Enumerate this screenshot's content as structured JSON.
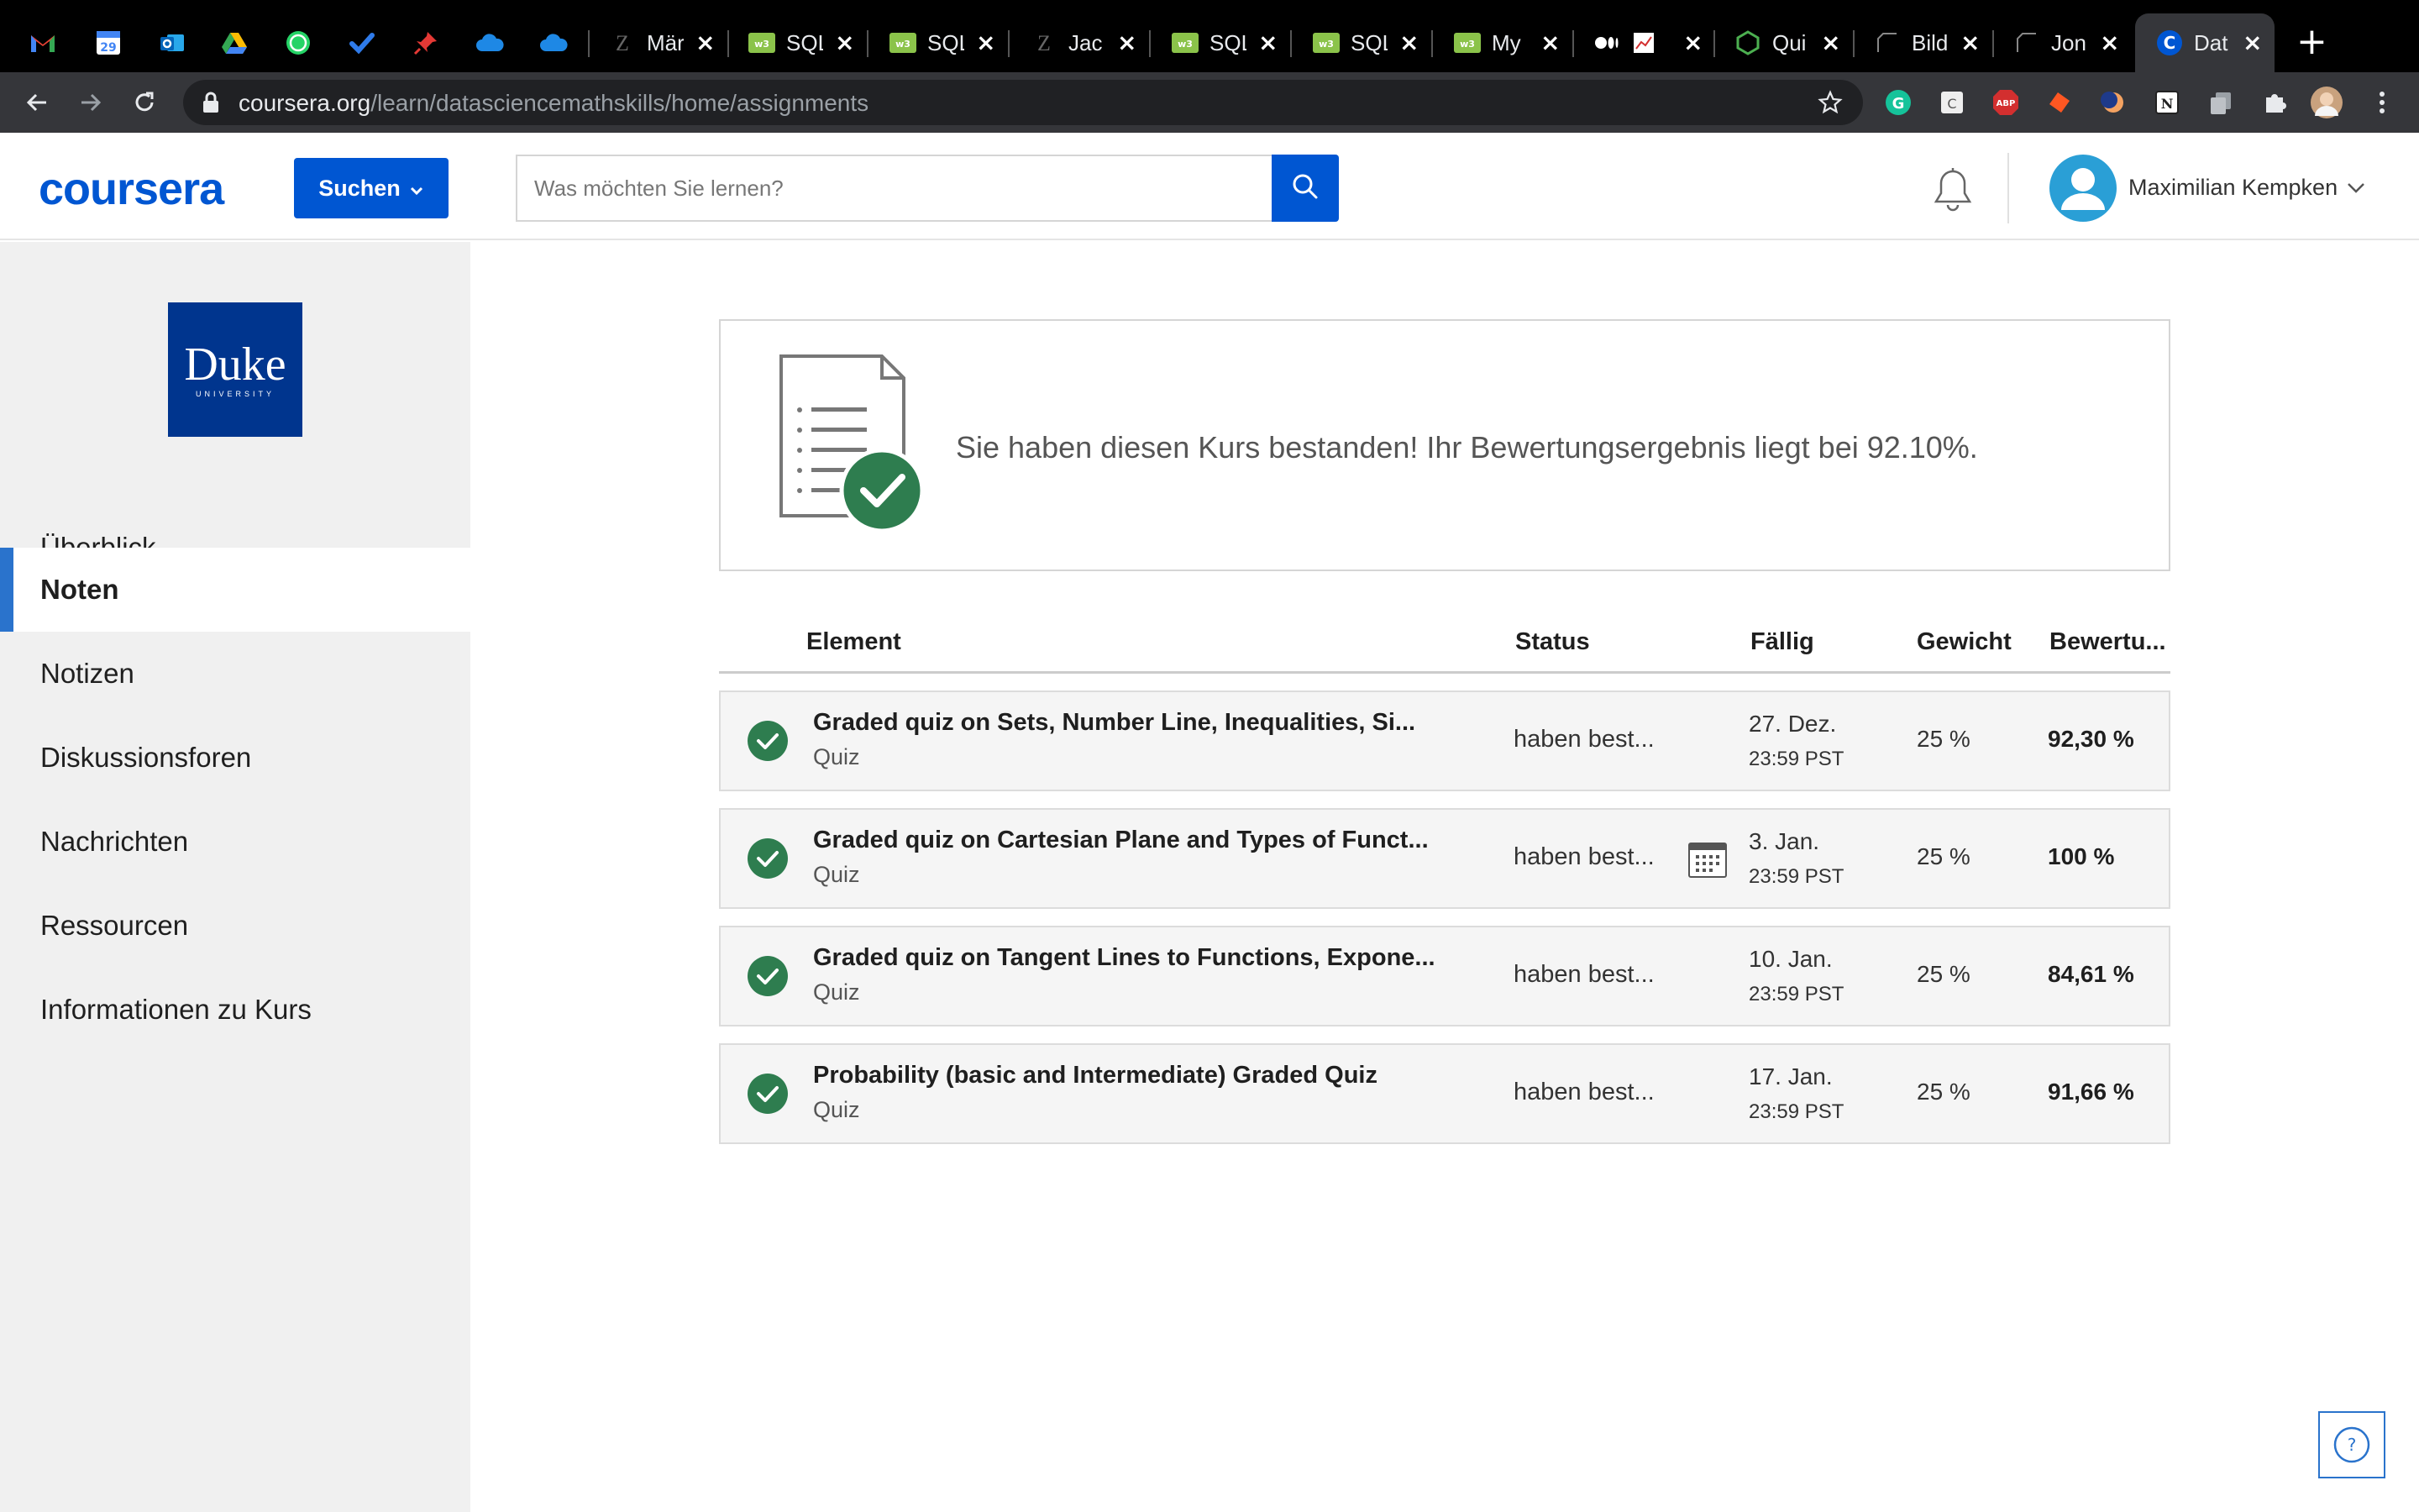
{
  "browser": {
    "tabs": [
      {
        "icon": "gmail-icon",
        "title": ""
      },
      {
        "icon": "calendar-icon",
        "title": ""
      },
      {
        "icon": "outlook-icon",
        "title": ""
      },
      {
        "icon": "drive-icon",
        "title": ""
      },
      {
        "icon": "whatsapp-icon",
        "title": ""
      },
      {
        "icon": "todo-icon",
        "title": ""
      },
      {
        "icon": "pin-icon",
        "title": ""
      },
      {
        "icon": "cloud-icon",
        "title": ""
      },
      {
        "icon": "cloud-icon",
        "title": ""
      },
      {
        "icon": "zoom-icon",
        "title": "Mär"
      },
      {
        "icon": "sql-icon",
        "title": "SQL"
      },
      {
        "icon": "sql-icon",
        "title": "SQL"
      },
      {
        "icon": "zoom-icon",
        "title": "Jac"
      },
      {
        "icon": "sql-icon",
        "title": "SQL"
      },
      {
        "icon": "sql-icon",
        "title": "SQL"
      },
      {
        "icon": "sql-icon",
        "title": "My"
      },
      {
        "icon": "medium-icon",
        "title": ""
      },
      {
        "icon": "quiz-icon",
        "title": "Qui"
      },
      {
        "icon": "page-icon",
        "title": "Bild"
      },
      {
        "icon": "page-icon",
        "title": "Jon"
      },
      {
        "icon": "coursera-icon",
        "title": "Dat"
      }
    ],
    "url_host": "coursera.org",
    "url_path": "/learn/datasciencemathskills/home/assignments"
  },
  "header": {
    "logo": "coursera",
    "search_button": "Suchen",
    "search_placeholder": "Was möchten Sie lernen?",
    "user_name": "Maximilian Kempken"
  },
  "sidebar": {
    "university_logo": "Duke",
    "university_sub": "UNIVERSITY",
    "items": [
      {
        "label": "Überblick"
      },
      {
        "label": "Noten"
      },
      {
        "label": "Notizen"
      },
      {
        "label": "Diskussionsforen"
      },
      {
        "label": "Nachrichten"
      },
      {
        "label": "Ressourcen"
      },
      {
        "label": "Informationen zu Kurs"
      }
    ]
  },
  "banner": {
    "text": "Sie haben diesen Kurs bestanden! Ihr Bewertungsergebnis liegt bei 92.10%."
  },
  "table": {
    "headers": {
      "element": "Element",
      "status": "Status",
      "due": "Fällig",
      "weight": "Gewicht",
      "grade": "Bewertu..."
    },
    "rows": [
      {
        "title": "Graded quiz on Sets, Number Line, Inequalities, Si...",
        "type": "Quiz",
        "status": "haben best...",
        "due_date": "27. Dez.",
        "due_time": "23:59 PST",
        "weight": "25 %",
        "grade": "92,30 %"
      },
      {
        "title": "Graded quiz on Cartesian Plane and Types of Funct...",
        "type": "Quiz",
        "status": "haben best...",
        "due_date": "3. Jan.",
        "due_time": "23:59 PST",
        "weight": "25 %",
        "grade": "100 %"
      },
      {
        "title": "Graded quiz on Tangent Lines to Functions, Expone...",
        "type": "Quiz",
        "status": "haben best...",
        "due_date": "10. Jan.",
        "due_time": "23:59 PST",
        "weight": "25 %",
        "grade": "84,61 %"
      },
      {
        "title": "Probability (basic and Intermediate) Graded Quiz",
        "type": "Quiz",
        "status": "haben best...",
        "due_date": "17. Jan.",
        "due_time": "23:59 PST",
        "weight": "25 %",
        "grade": "91,66 %"
      }
    ]
  },
  "help": {
    "label": "?"
  },
  "colors": {
    "brand_blue": "#0056d2",
    "success_green": "#2e7d4f",
    "sidebar_active": "#2a73cc",
    "duke_blue": "#00358e"
  }
}
